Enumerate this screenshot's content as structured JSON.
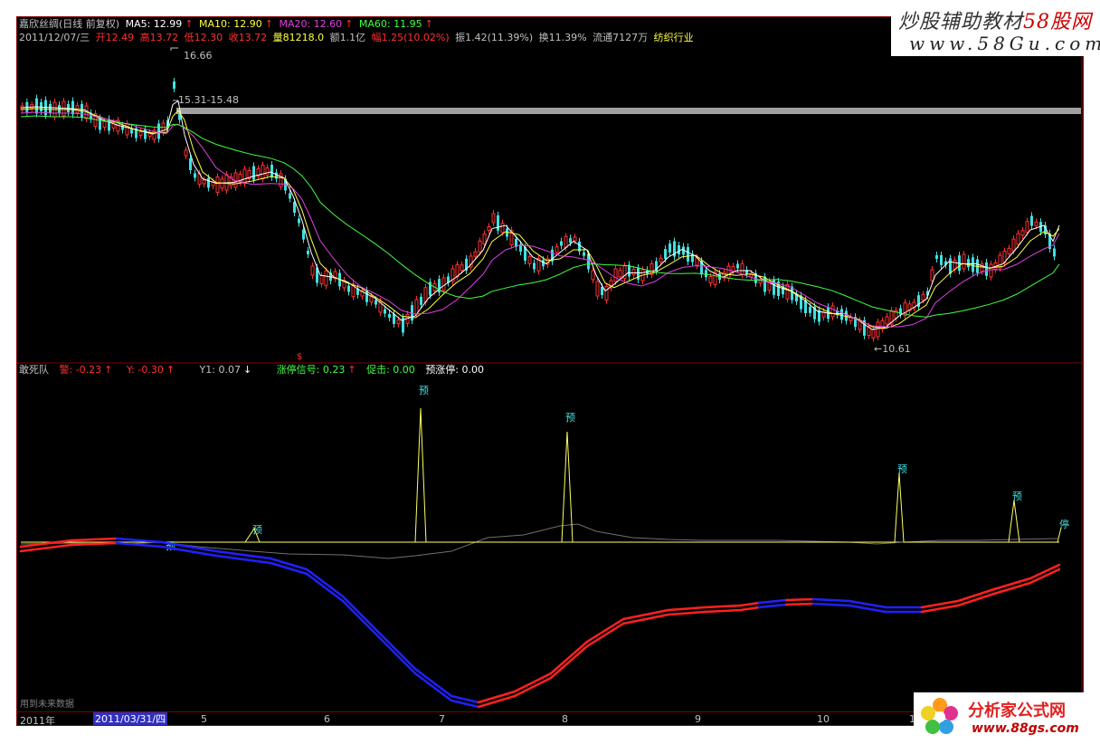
{
  "header": {
    "stock": "嘉欣丝绸(日线 前复权)",
    "ma": [
      {
        "label": "MA5: 12.99",
        "color": "#ffffff"
      },
      {
        "label": "MA10: 12.90",
        "color": "#ffff40"
      },
      {
        "label": "MA20: 12.60",
        "color": "#e040e0"
      },
      {
        "label": "MA60: 11.95",
        "color": "#40ff40"
      }
    ],
    "date": "2011/12/07/三",
    "open": "开12.49",
    "high": "高13.72",
    "low": "低12.30",
    "close": "收13.72",
    "volume": "量81218.0",
    "amount": "额1.1亿",
    "change": "幅1.25(10.02%)",
    "amplitude": "振1.42(11.39%)",
    "turnover": "换11.39%",
    "float": "流通7127万",
    "industry": "纺织行业"
  },
  "price_labels": {
    "high": "16.66",
    "band": "15.31-15.48",
    "low": "←10.61"
  },
  "indicator": {
    "name": "敢死队",
    "items": [
      {
        "label": "警: -0.23",
        "color": "#ff3030",
        "arrow": "↑",
        "arrow_color": "#ff3030"
      },
      {
        "label": "Y: -0.30",
        "color": "#ff3030",
        "arrow": "↑",
        "arrow_color": "#ff3030"
      },
      {
        "label": "Y1: 0.07",
        "color": "#c0c0c0",
        "arrow": "↓",
        "arrow_color": "#ffffff"
      },
      {
        "label": "涨停信号: 0.23",
        "color": "#40ff40",
        "arrow": "↑",
        "arrow_color": "#ff3030"
      },
      {
        "label": "促击: 0.00",
        "color": "#40ff40",
        "arrow": "",
        "arrow_color": ""
      },
      {
        "label": "预涨停: 0.00",
        "color": "#ffffff",
        "arrow": "",
        "arrow_color": ""
      }
    ],
    "marker_yu": "预",
    "marker_ting": "停"
  },
  "axis": {
    "year": "2011年",
    "cursor_date": "2011/03/31/四",
    "months": [
      "5",
      "6",
      "7",
      "8",
      "9",
      "10",
      "1"
    ]
  },
  "future_note": "用到未来数据",
  "watermark_top": {
    "line1": "炒股辅助教材",
    "line1_brand": "58股网",
    "line2": "www.58Gu.com"
  },
  "watermark_bottom": {
    "line1": "分析家公式网",
    "line2": "www.88gs.com"
  },
  "colors": {
    "up": "#ff3030",
    "down": "#40e0e0",
    "ma5": "#ffffff",
    "ma10": "#ffff40",
    "ma20": "#e040e0",
    "ma60": "#40ff40",
    "curve_red": "#ff2020",
    "curve_blue": "#2020ff"
  }
}
